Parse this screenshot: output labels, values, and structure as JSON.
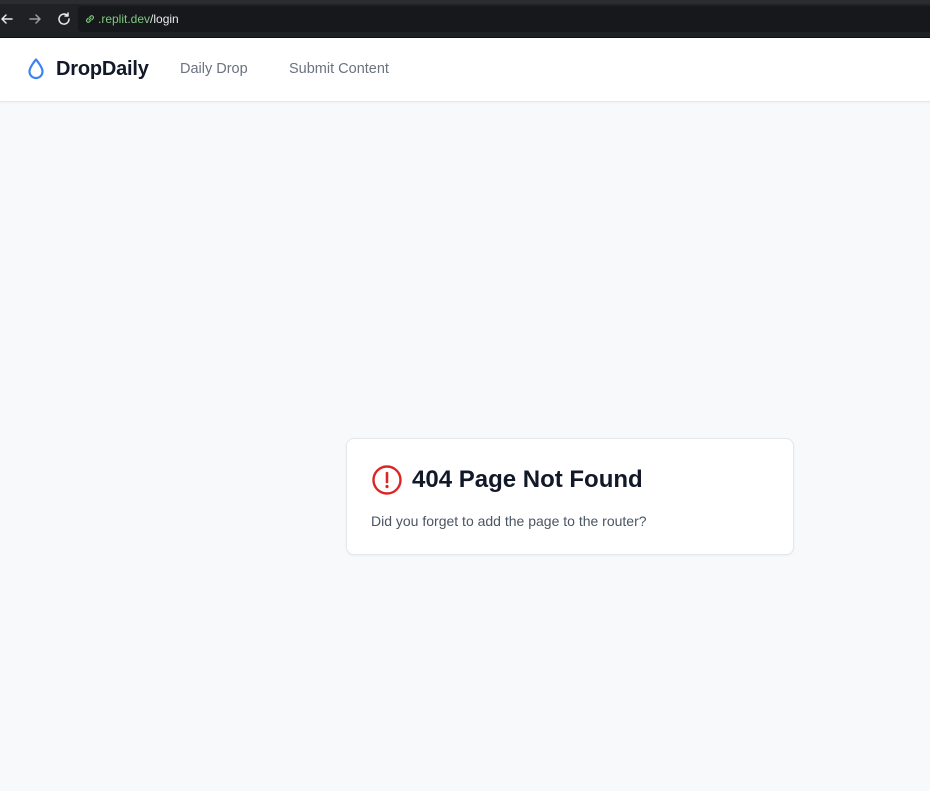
{
  "browser": {
    "url_domain": ".replit.dev",
    "url_path": "/login"
  },
  "header": {
    "brand": "DropDaily",
    "nav": [
      {
        "label": "Daily Drop"
      },
      {
        "label": "Submit Content"
      }
    ]
  },
  "error_card": {
    "title": "404 Page Not Found",
    "message": "Did you forget to add the page to the router?"
  },
  "colors": {
    "accent": "#3b82f6",
    "error": "#dc2626",
    "background": "#f8f9fb"
  }
}
